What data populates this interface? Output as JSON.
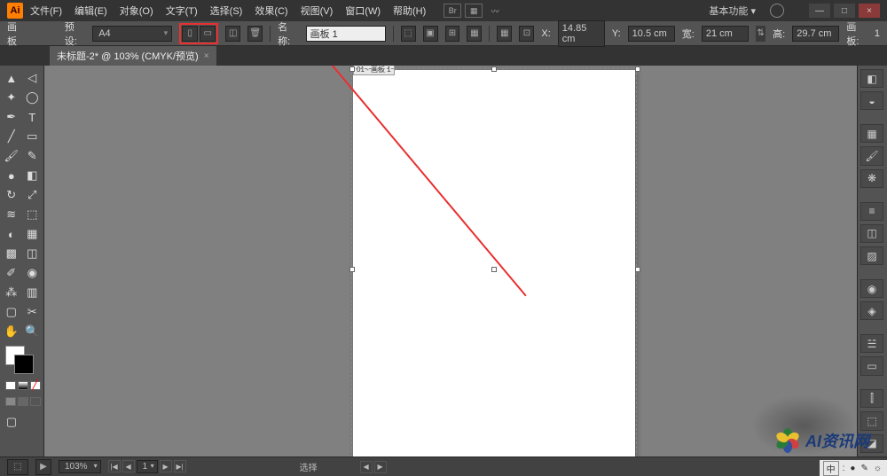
{
  "menubar": {
    "logo": "Ai",
    "items": [
      "文件(F)",
      "编辑(E)",
      "对象(O)",
      "文字(T)",
      "选择(S)",
      "效果(C)",
      "视图(V)",
      "窗口(W)",
      "帮助(H)"
    ],
    "workspace": "基本功能",
    "minimize": "—",
    "maximize": "□",
    "close": "×"
  },
  "controlbar": {
    "artboard_label": "画板",
    "preset_label": "预设:",
    "preset_value": "A4",
    "name_label": "名称:",
    "name_value": "画板 1",
    "x_label": "X:",
    "x_value": "14.85 cm",
    "y_label": "Y:",
    "y_value": "10.5 cm",
    "w_label": "宽:",
    "w_value": "21 cm",
    "h_label": "高:",
    "h_value": "29.7 cm",
    "artboards_label": "画板:",
    "artboards_value": "1"
  },
  "tab": {
    "title": "未标题-2* @ 103% (CMYK/预览)",
    "close": "×"
  },
  "artboard": {
    "label": "01 - 画板 1"
  },
  "statusbar": {
    "zoom": "103%",
    "select_label": "选择"
  },
  "watermark": {
    "text": "AI资讯网"
  },
  "langbar": {
    "items": [
      "中",
      ":",
      "●",
      "✎",
      "☼"
    ]
  },
  "tools": [
    [
      "selection",
      "direct-selection"
    ],
    [
      "magic-wand",
      "lasso"
    ],
    [
      "pen",
      "type"
    ],
    [
      "line",
      "rectangle"
    ],
    [
      "paintbrush",
      "pencil"
    ],
    [
      "blob-brush",
      "eraser"
    ],
    [
      "rotate",
      "scale"
    ],
    [
      "width",
      "free-transform"
    ],
    [
      "shape-builder",
      "perspective"
    ],
    [
      "mesh",
      "gradient"
    ],
    [
      "eyedropper",
      "blend"
    ],
    [
      "symbol-sprayer",
      "graph"
    ],
    [
      "artboard",
      "slice"
    ],
    [
      "hand",
      "zoom"
    ]
  ],
  "right_panels": [
    "color",
    "swatches",
    "brushes",
    "symbols",
    "stroke",
    "gradient",
    "transparency",
    "appearance",
    "graphic-styles",
    "layers",
    "align",
    "transform",
    "pathfinder",
    "artboards",
    "links",
    "actions"
  ]
}
